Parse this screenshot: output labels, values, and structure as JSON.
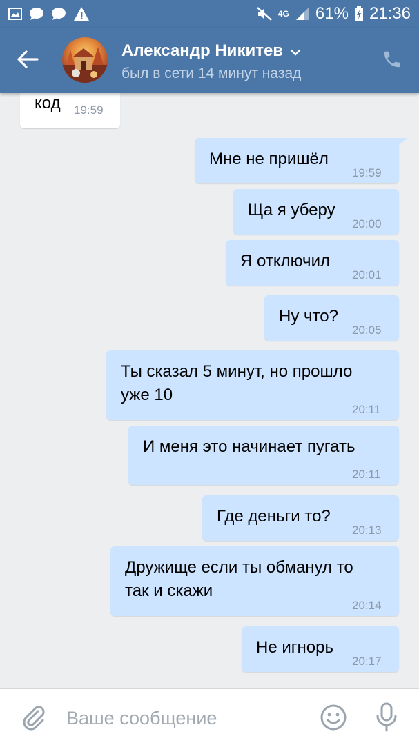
{
  "status_bar": {
    "icons_left": [
      "gallery-icon",
      "chat-icon",
      "chat-icon",
      "warning-icon"
    ],
    "network": "4G",
    "battery": "61%",
    "time": "21:36"
  },
  "header": {
    "contact_name": "Александр Никитев",
    "contact_status": "был в сети 14 минут назад",
    "icons": [
      "arrow-left-icon",
      "chevron-down-icon",
      "phone-icon"
    ],
    "color": "#4a76a8"
  },
  "messages": [
    {
      "dir": "in",
      "text": "код",
      "time": "19:59"
    },
    {
      "dir": "out",
      "text": "Мне не пришёл",
      "time": "19:59"
    },
    {
      "dir": "out",
      "text": "Ща я уберу",
      "time": "20:00"
    },
    {
      "dir": "out",
      "text": "Я отключил",
      "time": "20:01"
    },
    {
      "dir": "out",
      "text": "Ну что?",
      "time": "20:05"
    },
    {
      "dir": "out",
      "text": "Ты сказал 5 минут, но прошло\nуже 10",
      "time": "20:11"
    },
    {
      "dir": "out",
      "text": "И меня это начинает пугать",
      "time": "20:11"
    },
    {
      "dir": "out",
      "text": "Где деньги то?",
      "time": "20:13"
    },
    {
      "dir": "out",
      "text": "Дружище если ты обманул то\nтак и скажи",
      "time": "20:14"
    },
    {
      "dir": "out",
      "text": "Не игнорь",
      "time": "20:17"
    }
  ],
  "input_bar": {
    "placeholder": "Ваше сообщение",
    "value": "",
    "icons": [
      "paperclip-icon",
      "emoji-icon",
      "microphone-icon"
    ]
  },
  "colors": {
    "outgoing_bubble": "#cce4ff",
    "incoming_bubble": "#ffffff",
    "background": "#edeef0",
    "time_text": "#8c99a8"
  }
}
